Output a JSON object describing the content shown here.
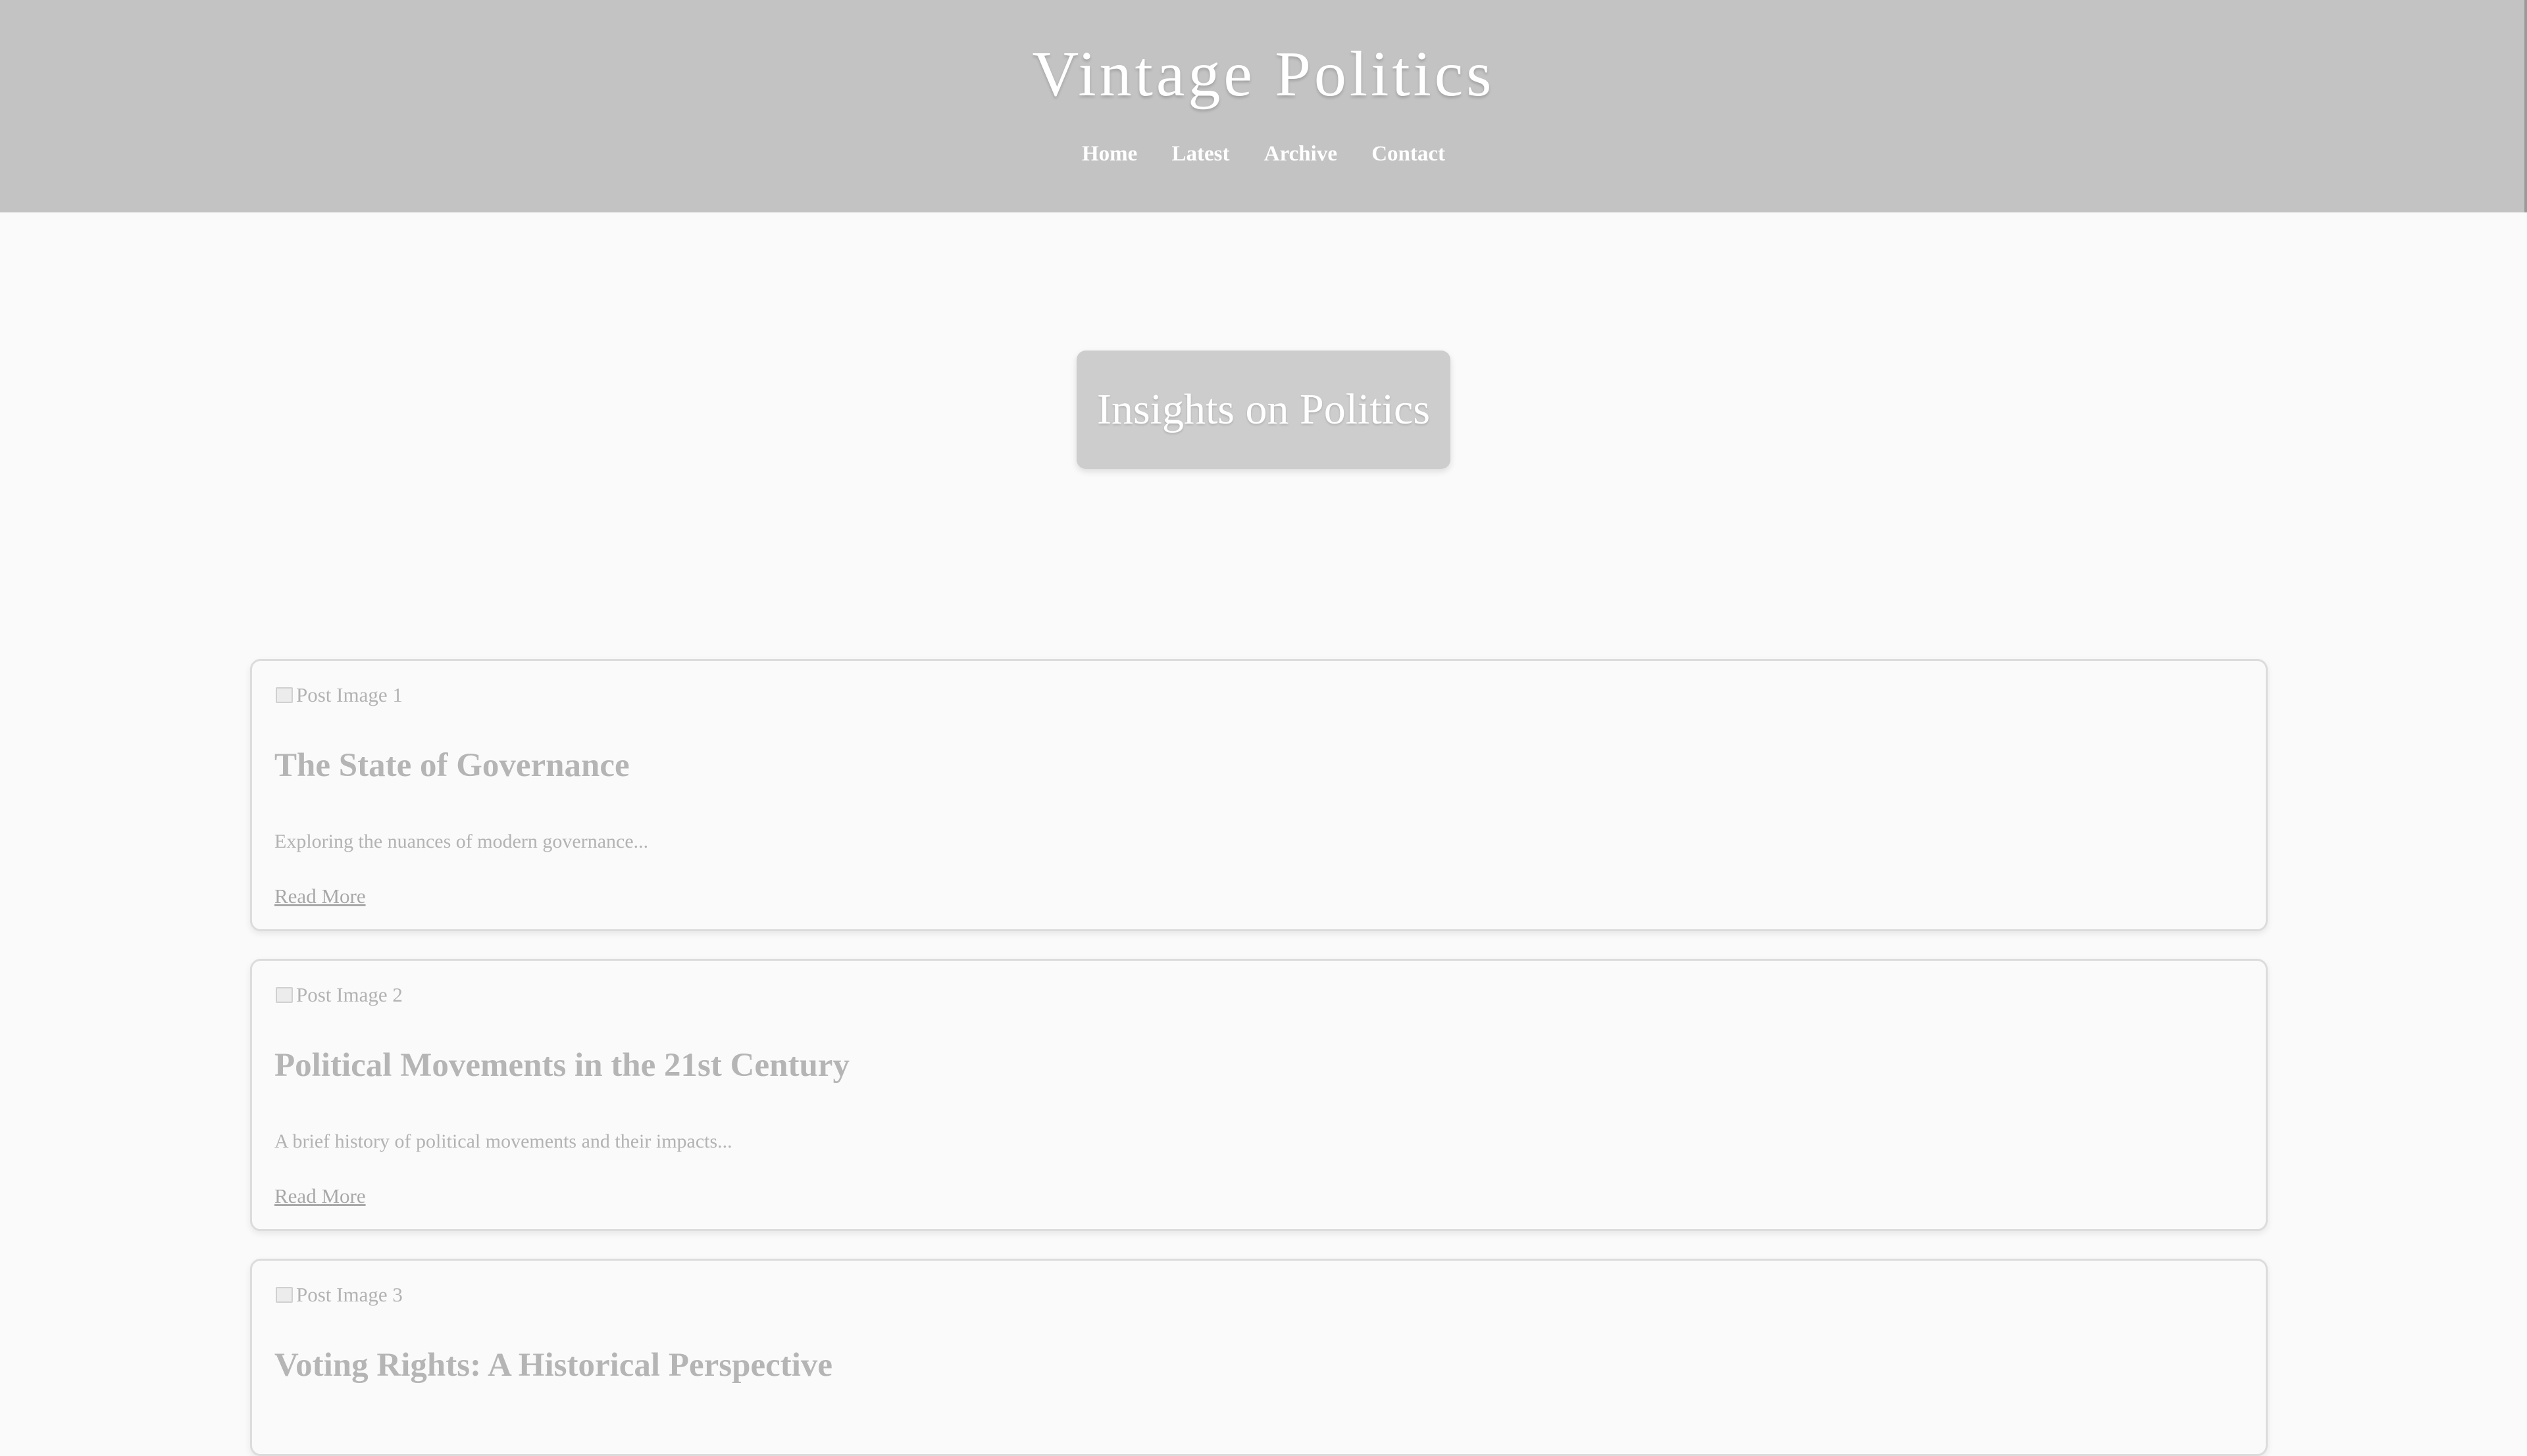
{
  "header": {
    "title": "Vintage Politics",
    "nav": [
      "Home",
      "Latest",
      "Archive",
      "Contact"
    ]
  },
  "hero": {
    "title": "Insights on Politics"
  },
  "posts": [
    {
      "image_alt": "Post Image 1",
      "title": "The State of Governance",
      "excerpt": "Exploring the nuances of modern governance...",
      "link": "Read More"
    },
    {
      "image_alt": "Post Image 2",
      "title": "Political Movements in the 21st Century",
      "excerpt": "A brief history of political movements and their impacts...",
      "link": "Read More"
    },
    {
      "image_alt": "Post Image 3",
      "title": "Voting Rights: A Historical Perspective"
    }
  ],
  "colors": {
    "header_bg": "#c3c3c3",
    "page_bg": "#fafafa",
    "hero_bg": "#cdcdcd",
    "text_muted": "#b3b3b3"
  }
}
